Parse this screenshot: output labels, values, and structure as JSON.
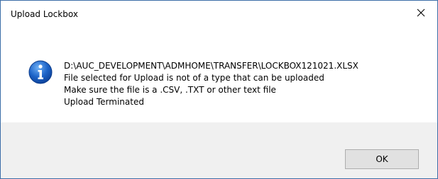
{
  "window": {
    "title": "Upload Lockbox",
    "close_icon": "close-icon"
  },
  "message": {
    "icon": "info-icon",
    "lines": [
      "D:\\AUC_DEVELOPMENT\\ADMHOME\\TRANSFER\\LOCKBOX121021.XLSX",
      "File selected for Upload is not of a type that can be uploaded",
      "Make sure the file is a .CSV, .TXT or other text file",
      "Upload Terminated"
    ]
  },
  "buttons": {
    "ok_label": "OK"
  },
  "colors": {
    "window_border": "#3c6ea8",
    "footer_background": "#f0f0f0",
    "button_face": "#e1e1e1",
    "icon_blue": "#1e64c8"
  }
}
